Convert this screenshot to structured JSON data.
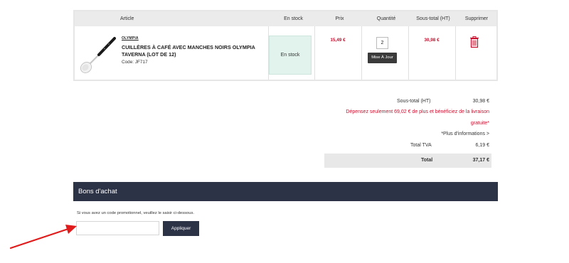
{
  "cart": {
    "headers": {
      "article": "Article",
      "stock": "En stock",
      "price": "Prix",
      "quantity": "Quantité",
      "subtotal": "Sous-total (HT)",
      "delete": "Supprimer"
    },
    "item": {
      "brand": "OLYMPIA",
      "name": "CUILLÈRES À CAFÉ AVEC MANCHES NOIRS OLYMPIA TAVERNA (LOT DE 12)",
      "code": "Code: JF717",
      "stock": "En stock",
      "price": "15,49 €",
      "quantity": "2",
      "update_label": "Mise À Jour",
      "subtotal": "30,98 €",
      "delete_icon": "trash-icon"
    }
  },
  "totals": {
    "subtotal_label": "Sous-total (HT)",
    "subtotal_value": "30,98 €",
    "promo_line1": "Dépensez seulement 69,02 € de plus et bénéficiez de la livraison",
    "promo_line2": "gratuite*",
    "more_info": "*Plus d'informations >",
    "tva_label": "Total TVA",
    "tva_value": "6,19 €",
    "total_label": "Total",
    "total_value": "37,17 €"
  },
  "voucher": {
    "title": "Bons d'achat",
    "instructions": "Si vous avez un code promotionnel, veuillez le saisir ci-dessous.",
    "input_value": "",
    "apply_label": "Appliquer"
  },
  "colors": {
    "accent_red": "#c8102e",
    "dark_navy": "#2d3346",
    "stock_green": "#e2f2ec",
    "arrow_red": "#e01b1b"
  }
}
